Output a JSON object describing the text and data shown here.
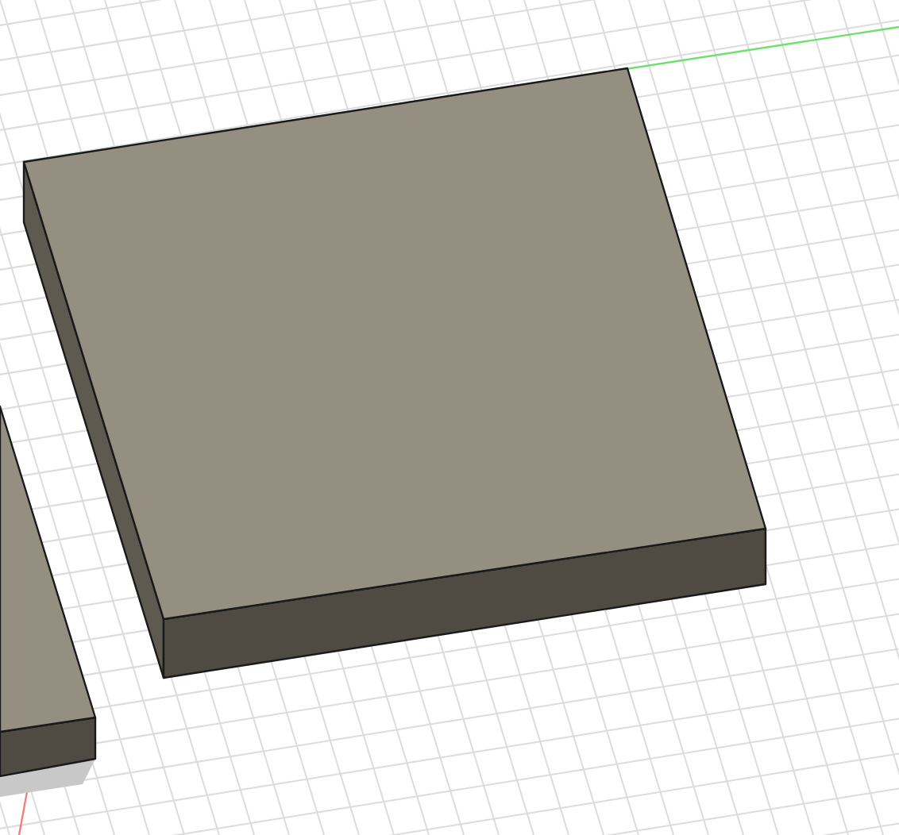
{
  "viewport": {
    "bodies": [
      {
        "kind": "box"
      },
      {
        "kind": "box"
      }
    ]
  }
}
